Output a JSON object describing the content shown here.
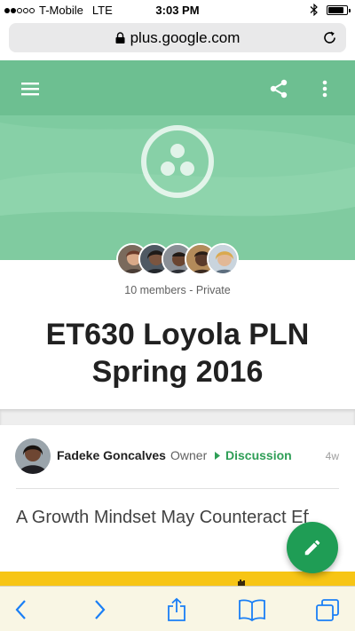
{
  "status_bar": {
    "carrier": "T-Mobile",
    "network": "LTE",
    "time": "3:03 PM",
    "signal_bars": 2,
    "battery_level": 0.85
  },
  "browser": {
    "url": "plus.google.com",
    "icons": [
      "lock-icon",
      "reload-icon"
    ]
  },
  "header": {
    "icons": [
      "menu-icon",
      "share-icon",
      "more-vert-icon",
      "community-icon"
    ],
    "colors": {
      "header_green": "#7ecba0",
      "topbar_green": "#6dbf91"
    }
  },
  "community": {
    "members_text": "10 members - Private",
    "title": "ET630 Loyola PLN Spring 2016",
    "member_avatar_count": 5
  },
  "post": {
    "author": "Fadeke Goncalves",
    "role": "Owner",
    "category": "Discussion",
    "time": "4w",
    "title": "A Growth Mindset May Counteract Effects of Poverty on Achievement",
    "accent_color": "#2e9e56"
  },
  "fab": {
    "icon": "pencil-icon",
    "color": "#1f9d55"
  },
  "toolbar": {
    "icons": [
      "back-icon",
      "forward-icon",
      "share-icon",
      "bookmarks-icon",
      "tabs-icon"
    ],
    "color": "#1a7ff6"
  }
}
